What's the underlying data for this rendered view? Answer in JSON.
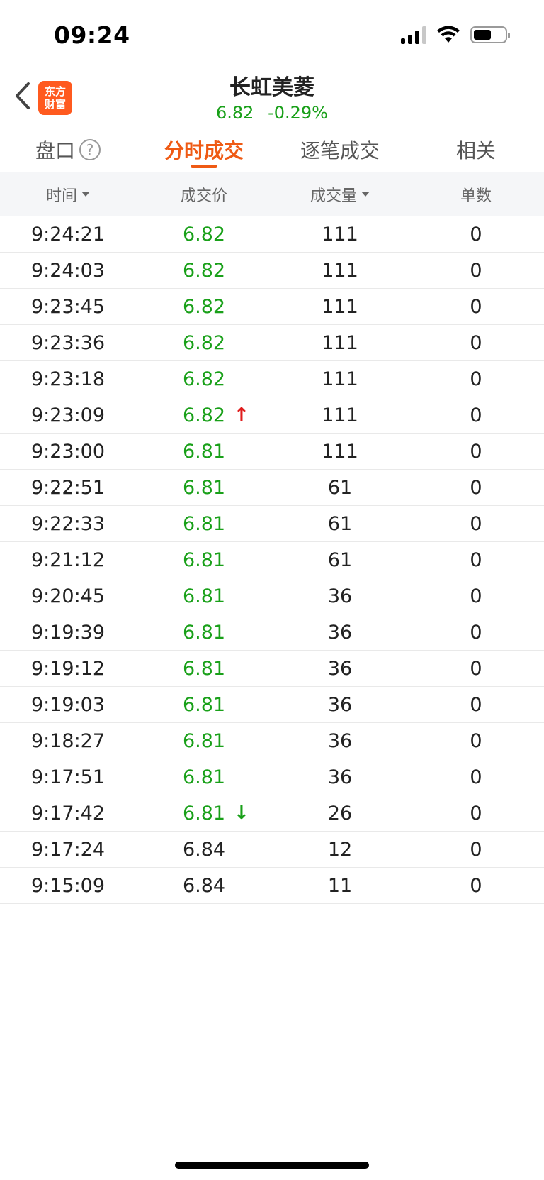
{
  "status_bar": {
    "time": "09:24"
  },
  "header": {
    "logo_line1": "东方",
    "logo_line2": "财富",
    "stock_name": "长虹美菱",
    "price": "6.82",
    "change_pct": "-0.29%",
    "colors": {
      "down": "#19a019",
      "up": "#e01c1c",
      "accent": "#ef5a14"
    }
  },
  "tabs": [
    {
      "label": "盘口",
      "help": "?"
    },
    {
      "label": "分时成交"
    },
    {
      "label": "逐笔成交"
    },
    {
      "label": "相关"
    }
  ],
  "columns": [
    "时间",
    "成交价",
    "成交量",
    "单数"
  ],
  "rows": [
    {
      "time": "9:24:21",
      "price": "6.82",
      "volume": "111",
      "count": "0",
      "color": "green",
      "arrow": ""
    },
    {
      "time": "9:24:03",
      "price": "6.82",
      "volume": "111",
      "count": "0",
      "color": "green",
      "arrow": ""
    },
    {
      "time": "9:23:45",
      "price": "6.82",
      "volume": "111",
      "count": "0",
      "color": "green",
      "arrow": ""
    },
    {
      "time": "9:23:36",
      "price": "6.82",
      "volume": "111",
      "count": "0",
      "color": "green",
      "arrow": ""
    },
    {
      "time": "9:23:18",
      "price": "6.82",
      "volume": "111",
      "count": "0",
      "color": "green",
      "arrow": ""
    },
    {
      "time": "9:23:09",
      "price": "6.82",
      "volume": "111",
      "count": "0",
      "color": "green",
      "arrow": "↑"
    },
    {
      "time": "9:23:00",
      "price": "6.81",
      "volume": "111",
      "count": "0",
      "color": "green",
      "arrow": ""
    },
    {
      "time": "9:22:51",
      "price": "6.81",
      "volume": "61",
      "count": "0",
      "color": "green",
      "arrow": ""
    },
    {
      "time": "9:22:33",
      "price": "6.81",
      "volume": "61",
      "count": "0",
      "color": "green",
      "arrow": ""
    },
    {
      "time": "9:21:12",
      "price": "6.81",
      "volume": "61",
      "count": "0",
      "color": "green",
      "arrow": ""
    },
    {
      "time": "9:20:45",
      "price": "6.81",
      "volume": "36",
      "count": "0",
      "color": "green",
      "arrow": ""
    },
    {
      "time": "9:19:39",
      "price": "6.81",
      "volume": "36",
      "count": "0",
      "color": "green",
      "arrow": ""
    },
    {
      "time": "9:19:12",
      "price": "6.81",
      "volume": "36",
      "count": "0",
      "color": "green",
      "arrow": ""
    },
    {
      "time": "9:19:03",
      "price": "6.81",
      "volume": "36",
      "count": "0",
      "color": "green",
      "arrow": ""
    },
    {
      "time": "9:18:27",
      "price": "6.81",
      "volume": "36",
      "count": "0",
      "color": "green",
      "arrow": ""
    },
    {
      "time": "9:17:51",
      "price": "6.81",
      "volume": "36",
      "count": "0",
      "color": "green",
      "arrow": ""
    },
    {
      "time": "9:17:42",
      "price": "6.81",
      "volume": "26",
      "count": "0",
      "color": "green",
      "arrow": "↓"
    },
    {
      "time": "9:17:24",
      "price": "6.84",
      "volume": "12",
      "count": "0",
      "color": "neutral",
      "arrow": ""
    },
    {
      "time": "9:15:09",
      "price": "6.84",
      "volume": "11",
      "count": "0",
      "color": "neutral",
      "arrow": ""
    }
  ]
}
